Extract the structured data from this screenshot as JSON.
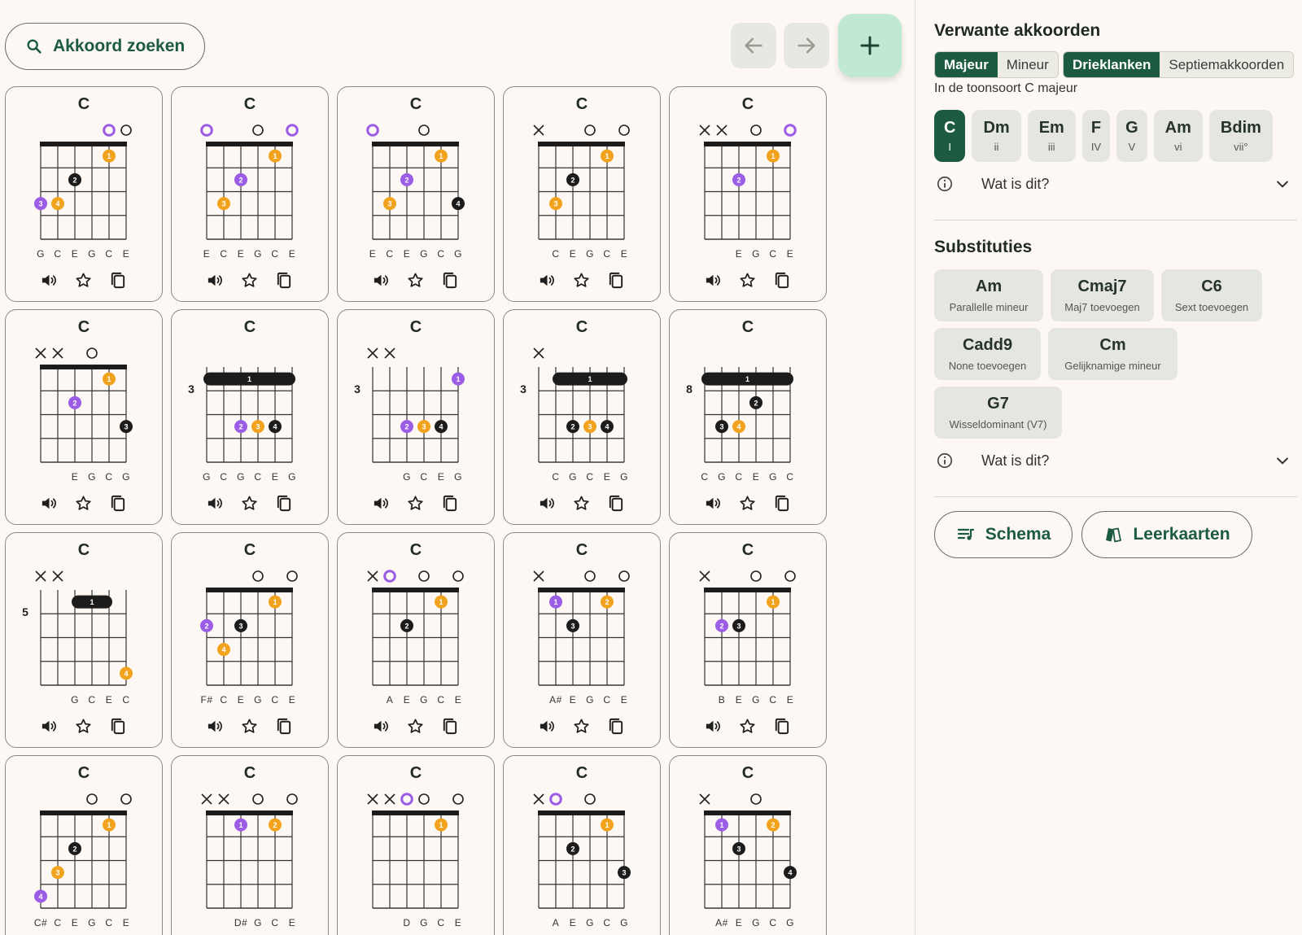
{
  "toolbar": {
    "search_label": "Akkoord zoeken",
    "icons": {
      "search": "search-icon",
      "back": "arrow-left-icon",
      "forward": "arrow-right-icon",
      "add": "plus-icon"
    }
  },
  "colors": {
    "dark_dot": "#1c1c1c",
    "purple_dot": "#9b5ce6",
    "orange_dot": "#f2a31e",
    "primary": "#1d5a42",
    "add_button_bg": "#bfe9d3"
  },
  "card_icons": [
    "speaker-icon",
    "star-icon",
    "copy-icon"
  ],
  "cards": [
    {
      "title": "C",
      "base": null,
      "marks": [
        "",
        "",
        "",
        "",
        "p",
        "o"
      ],
      "dots": [
        {
          "s": 0,
          "f": 3,
          "c": "p",
          "n": "3"
        },
        {
          "s": 1,
          "f": 3,
          "c": "y",
          "n": "4"
        },
        {
          "s": 2,
          "f": 2,
          "c": "k",
          "n": "2"
        },
        {
          "s": 4,
          "f": 1,
          "c": "y",
          "n": "1"
        }
      ],
      "barres": [],
      "notes": [
        "G",
        "C",
        "E",
        "G",
        "C",
        "E"
      ]
    },
    {
      "title": "C",
      "base": null,
      "marks": [
        "p",
        "",
        "",
        "o",
        "",
        "p"
      ],
      "dots": [
        {
          "s": 1,
          "f": 3,
          "c": "y",
          "n": "3"
        },
        {
          "s": 2,
          "f": 2,
          "c": "p",
          "n": "2"
        },
        {
          "s": 4,
          "f": 1,
          "c": "y",
          "n": "1"
        }
      ],
      "barres": [],
      "notes": [
        "E",
        "C",
        "E",
        "G",
        "C",
        "E"
      ]
    },
    {
      "title": "C",
      "base": null,
      "marks": [
        "p",
        "",
        "",
        "o",
        "",
        ""
      ],
      "dots": [
        {
          "s": 1,
          "f": 3,
          "c": "y",
          "n": "3"
        },
        {
          "s": 2,
          "f": 2,
          "c": "p",
          "n": "2"
        },
        {
          "s": 4,
          "f": 1,
          "c": "y",
          "n": "1"
        },
        {
          "s": 5,
          "f": 3,
          "c": "k",
          "n": "4"
        }
      ],
      "barres": [],
      "notes": [
        "E",
        "C",
        "E",
        "G",
        "C",
        "G"
      ]
    },
    {
      "title": "C",
      "base": null,
      "marks": [
        "x",
        "",
        "",
        "o",
        "",
        "o"
      ],
      "dots": [
        {
          "s": 1,
          "f": 3,
          "c": "y",
          "n": "3"
        },
        {
          "s": 2,
          "f": 2,
          "c": "k",
          "n": "2"
        },
        {
          "s": 4,
          "f": 1,
          "c": "y",
          "n": "1"
        }
      ],
      "barres": [],
      "notes": [
        "",
        "C",
        "E",
        "G",
        "C",
        "E"
      ]
    },
    {
      "title": "C",
      "base": null,
      "marks": [
        "x",
        "x",
        "",
        "o",
        "",
        "p"
      ],
      "dots": [
        {
          "s": 2,
          "f": 2,
          "c": "p",
          "n": "2"
        },
        {
          "s": 4,
          "f": 1,
          "c": "y",
          "n": "1"
        }
      ],
      "barres": [],
      "notes": [
        "",
        "",
        "E",
        "G",
        "C",
        "E"
      ]
    },
    {
      "title": "C",
      "base": null,
      "marks": [
        "x",
        "x",
        "",
        "o",
        "",
        ""
      ],
      "dots": [
        {
          "s": 2,
          "f": 2,
          "c": "p",
          "n": "2"
        },
        {
          "s": 4,
          "f": 1,
          "c": "y",
          "n": "1"
        },
        {
          "s": 5,
          "f": 3,
          "c": "k",
          "n": "3"
        }
      ],
      "barres": [],
      "notes": [
        "",
        "",
        "E",
        "G",
        "C",
        "G"
      ]
    },
    {
      "title": "C",
      "base": "3",
      "marks": [
        "",
        "",
        "",
        "",
        "",
        ""
      ],
      "dots": [
        {
          "s": 2,
          "f": 3,
          "c": "p",
          "n": "2"
        },
        {
          "s": 3,
          "f": 3,
          "c": "y",
          "n": "3"
        },
        {
          "s": 4,
          "f": 3,
          "c": "k",
          "n": "4"
        }
      ],
      "barres": [
        {
          "from": 0,
          "to": 5,
          "f": 1,
          "n": "1"
        }
      ],
      "notes": [
        "G",
        "C",
        "G",
        "C",
        "E",
        "G"
      ]
    },
    {
      "title": "C",
      "base": "3",
      "marks": [
        "x",
        "x",
        "",
        "",
        "",
        ""
      ],
      "dots": [
        {
          "s": 2,
          "f": 3,
          "c": "p",
          "n": "2"
        },
        {
          "s": 3,
          "f": 3,
          "c": "y",
          "n": "3"
        },
        {
          "s": 4,
          "f": 3,
          "c": "k",
          "n": "4"
        },
        {
          "s": 5,
          "f": 1,
          "c": "p",
          "n": "1"
        }
      ],
      "barres": [],
      "notes": [
        "",
        "",
        "G",
        "C",
        "E",
        "G"
      ]
    },
    {
      "title": "C",
      "base": "3",
      "marks": [
        "x",
        "",
        "",
        "",
        "",
        ""
      ],
      "dots": [
        {
          "s": 2,
          "f": 3,
          "c": "k",
          "n": "2"
        },
        {
          "s": 3,
          "f": 3,
          "c": "y",
          "n": "3"
        },
        {
          "s": 4,
          "f": 3,
          "c": "k",
          "n": "4"
        }
      ],
      "barres": [
        {
          "from": 1,
          "to": 5,
          "f": 1,
          "n": "1"
        }
      ],
      "notes": [
        "",
        "C",
        "G",
        "C",
        "E",
        "G"
      ]
    },
    {
      "title": "C",
      "base": "8",
      "marks": [
        "",
        "",
        "",
        "",
        "",
        ""
      ],
      "dots": [
        {
          "s": 1,
          "f": 3,
          "c": "k",
          "n": "3"
        },
        {
          "s": 2,
          "f": 3,
          "c": "y",
          "n": "4"
        },
        {
          "s": 3,
          "f": 2,
          "c": "k",
          "n": "2"
        }
      ],
      "barres": [
        {
          "from": 0,
          "to": 5,
          "f": 1,
          "n": "1"
        }
      ],
      "notes": [
        "C",
        "G",
        "C",
        "E",
        "G",
        "C"
      ]
    },
    {
      "title": "C",
      "base": "5",
      "marks": [
        "x",
        "x",
        "",
        "",
        "",
        ""
      ],
      "dots": [
        {
          "s": 5,
          "f": 4,
          "c": "y",
          "n": "4"
        }
      ],
      "barres": [
        {
          "from": 2,
          "to": 4,
          "f": 1,
          "n": "1"
        }
      ],
      "notes": [
        "",
        "",
        "G",
        "C",
        "E",
        "C"
      ]
    },
    {
      "title": "C",
      "base": null,
      "marks": [
        "",
        "",
        "",
        "o",
        "",
        "o"
      ],
      "dots": [
        {
          "s": 0,
          "f": 2,
          "c": "p",
          "n": "2"
        },
        {
          "s": 1,
          "f": 3,
          "c": "y",
          "n": "4"
        },
        {
          "s": 2,
          "f": 2,
          "c": "k",
          "n": "3"
        },
        {
          "s": 4,
          "f": 1,
          "c": "y",
          "n": "1"
        }
      ],
      "barres": [],
      "notes": [
        "F#",
        "C",
        "E",
        "G",
        "C",
        "E"
      ]
    },
    {
      "title": "C",
      "base": null,
      "marks": [
        "x",
        "p",
        "",
        "o",
        "",
        "o"
      ],
      "dots": [
        {
          "s": 2,
          "f": 2,
          "c": "k",
          "n": "2"
        },
        {
          "s": 4,
          "f": 1,
          "c": "y",
          "n": "1"
        }
      ],
      "barres": [],
      "notes": [
        "",
        "A",
        "E",
        "G",
        "C",
        "E"
      ]
    },
    {
      "title": "C",
      "base": null,
      "marks": [
        "x",
        "",
        "",
        "o",
        "",
        "o"
      ],
      "dots": [
        {
          "s": 1,
          "f": 1,
          "c": "p",
          "n": "1"
        },
        {
          "s": 2,
          "f": 2,
          "c": "k",
          "n": "3"
        },
        {
          "s": 4,
          "f": 1,
          "c": "y",
          "n": "2"
        }
      ],
      "barres": [],
      "notes": [
        "",
        "A#",
        "E",
        "G",
        "C",
        "E"
      ]
    },
    {
      "title": "C",
      "base": null,
      "marks": [
        "x",
        "",
        "",
        "o",
        "",
        "o"
      ],
      "dots": [
        {
          "s": 1,
          "f": 2,
          "c": "p",
          "n": "2"
        },
        {
          "s": 2,
          "f": 2,
          "c": "k",
          "n": "3"
        },
        {
          "s": 4,
          "f": 1,
          "c": "y",
          "n": "1"
        }
      ],
      "barres": [],
      "notes": [
        "",
        "B",
        "E",
        "G",
        "C",
        "E"
      ]
    },
    {
      "title": "C",
      "base": null,
      "marks": [
        "",
        "",
        "",
        "o",
        "",
        "o"
      ],
      "dots": [
        {
          "s": 0,
          "f": 4,
          "c": "p",
          "n": "4"
        },
        {
          "s": 1,
          "f": 3,
          "c": "y",
          "n": "3"
        },
        {
          "s": 2,
          "f": 2,
          "c": "k",
          "n": "2"
        },
        {
          "s": 4,
          "f": 1,
          "c": "y",
          "n": "1"
        }
      ],
      "barres": [],
      "notes": [
        "C#",
        "C",
        "E",
        "G",
        "C",
        "E"
      ]
    },
    {
      "title": "C",
      "base": null,
      "marks": [
        "x",
        "x",
        "",
        "o",
        "",
        "o"
      ],
      "dots": [
        {
          "s": 2,
          "f": 1,
          "c": "p",
          "n": "1"
        },
        {
          "s": 4,
          "f": 1,
          "c": "y",
          "n": "2"
        }
      ],
      "barres": [],
      "notes": [
        "",
        "",
        "D#",
        "G",
        "C",
        "E"
      ]
    },
    {
      "title": "C",
      "base": null,
      "marks": [
        "x",
        "x",
        "p",
        "o",
        "",
        "o"
      ],
      "dots": [
        {
          "s": 4,
          "f": 1,
          "c": "y",
          "n": "1"
        }
      ],
      "barres": [],
      "notes": [
        "",
        "",
        "D",
        "G",
        "C",
        "E"
      ]
    },
    {
      "title": "C",
      "base": null,
      "marks": [
        "x",
        "p",
        "",
        "o",
        "",
        ""
      ],
      "dots": [
        {
          "s": 2,
          "f": 2,
          "c": "k",
          "n": "2"
        },
        {
          "s": 4,
          "f": 1,
          "c": "y",
          "n": "1"
        },
        {
          "s": 5,
          "f": 3,
          "c": "k",
          "n": "3"
        }
      ],
      "barres": [],
      "notes": [
        "",
        "A",
        "E",
        "G",
        "C",
        "G"
      ]
    },
    {
      "title": "C",
      "base": null,
      "marks": [
        "x",
        "",
        "",
        "o",
        "",
        ""
      ],
      "dots": [
        {
          "s": 1,
          "f": 1,
          "c": "p",
          "n": "1"
        },
        {
          "s": 2,
          "f": 2,
          "c": "k",
          "n": "3"
        },
        {
          "s": 4,
          "f": 1,
          "c": "y",
          "n": "2"
        },
        {
          "s": 5,
          "f": 3,
          "c": "k",
          "n": "4"
        }
      ],
      "barres": [],
      "notes": [
        "",
        "A#",
        "E",
        "G",
        "C",
        "G"
      ]
    }
  ],
  "related": {
    "title": "Verwante akkoorden",
    "mode_tabs": [
      {
        "label": "Majeur",
        "active": true
      },
      {
        "label": "Mineur",
        "active": false
      }
    ],
    "type_tabs": [
      {
        "label": "Drieklanken",
        "active": true
      },
      {
        "label": "Septiemakkoorden",
        "active": false
      }
    ],
    "key_text": "In de toonsoort C majeur",
    "degrees": [
      {
        "name": "C",
        "roman": "I",
        "active": true
      },
      {
        "name": "Dm",
        "roman": "ii",
        "active": false
      },
      {
        "name": "Em",
        "roman": "iii",
        "active": false
      },
      {
        "name": "F",
        "roman": "IV",
        "active": false
      },
      {
        "name": "G",
        "roman": "V",
        "active": false
      },
      {
        "name": "Am",
        "roman": "vi",
        "active": false
      },
      {
        "name": "Bdim",
        "roman": "vii°",
        "active": false
      }
    ],
    "info_label": "Wat is dit?"
  },
  "substitutions": {
    "title": "Substituties",
    "items": [
      {
        "name": "Am",
        "desc": "Parallelle mineur"
      },
      {
        "name": "Cmaj7",
        "desc": "Maj7 toevoegen"
      },
      {
        "name": "C6",
        "desc": "Sext toevoegen"
      },
      {
        "name": "Cadd9",
        "desc": "None toevoegen"
      },
      {
        "name": "Cm",
        "desc": "Gelijknamige mineur"
      },
      {
        "name": "G7",
        "desc": "Wisseldominant (V7)"
      }
    ],
    "info_label": "Wat is dit?"
  },
  "footer_buttons": {
    "schema_label": "Schema",
    "flashcards_label": "Leerkaarten"
  }
}
